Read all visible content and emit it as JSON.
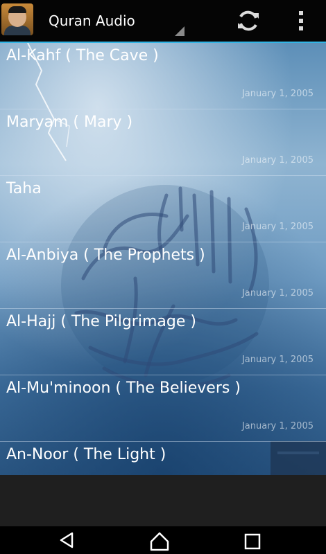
{
  "action_bar": {
    "title": "Quran Audio",
    "icons": {
      "app": "reciter-portrait-icon",
      "spinner": "dropdown-triangle-icon",
      "refresh": "refresh-icon",
      "overflow": "overflow-menu-icon"
    },
    "accent_color": "#33b5e5"
  },
  "surahs": [
    {
      "title": "Al-Kahf ( The Cave )",
      "date": "January 1, 2005"
    },
    {
      "title": "Maryam ( Mary )",
      "date": "January 1, 2005"
    },
    {
      "title": "Taha",
      "date": "January 1, 2005"
    },
    {
      "title": "Al-Anbiya ( The Prophets )",
      "date": "January 1, 2005"
    },
    {
      "title": "Al-Hajj ( The Pilgrimage )",
      "date": "January 1, 2005"
    },
    {
      "title": "Al-Mu'minoon ( The Believers )",
      "date": "January 1, 2005"
    },
    {
      "title": "An-Noor ( The Light )",
      "date": ""
    }
  ],
  "nav_bar": {
    "icons": {
      "back": "back-icon",
      "home": "home-icon",
      "recents": "recents-icon"
    }
  }
}
